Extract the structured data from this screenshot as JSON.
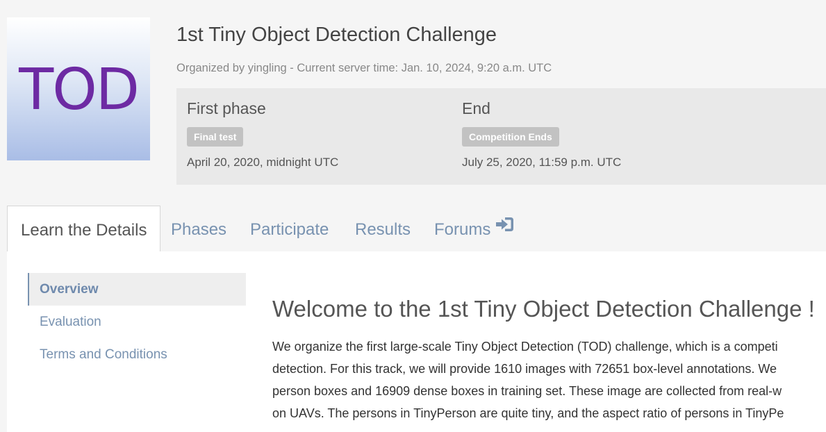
{
  "logo": {
    "text": "TOD",
    "color": "#6d2aa3"
  },
  "header": {
    "title": "1st Tiny Object Detection Challenge",
    "organized": "Organized by yingling - Current server time: Jan. 10, 2024, 9:20 a.m. UTC"
  },
  "phases": [
    {
      "name": "First phase",
      "label": "Final test",
      "date": "April 20, 2020, midnight UTC"
    },
    {
      "name": "End",
      "label": "Competition Ends",
      "date": "July 25, 2020, 11:59 p.m. UTC"
    }
  ],
  "tabs": {
    "learn": "Learn the Details",
    "phases": "Phases",
    "participate": "Participate",
    "results": "Results",
    "forums": "Forums",
    "forums_icon": "sign-in-icon",
    "active": "Learn the Details"
  },
  "sidenav": [
    {
      "label": "Overview",
      "active": true
    },
    {
      "label": "Evaluation",
      "active": false
    },
    {
      "label": "Terms and Conditions",
      "active": false
    }
  ],
  "main": {
    "heading": "Welcome to the 1st Tiny Object Detection Challenge !",
    "lines": [
      "We organize the first large-scale Tiny Object Detection (TOD) challenge, which is a competi",
      "detection. For this track, we will provide 1610 images with 72651 box-level annotations. We",
      "person boxes and 16909 dense boxes in training set. These image are collected from real-w",
      "on UAVs. The persons in TinyPerson are quite tiny, and the aspect ratio of persons in TinyPe"
    ]
  },
  "colors": {
    "link": "#7892b0",
    "badge": "#c2c2c2",
    "phase_box": "#e9e9e9"
  }
}
